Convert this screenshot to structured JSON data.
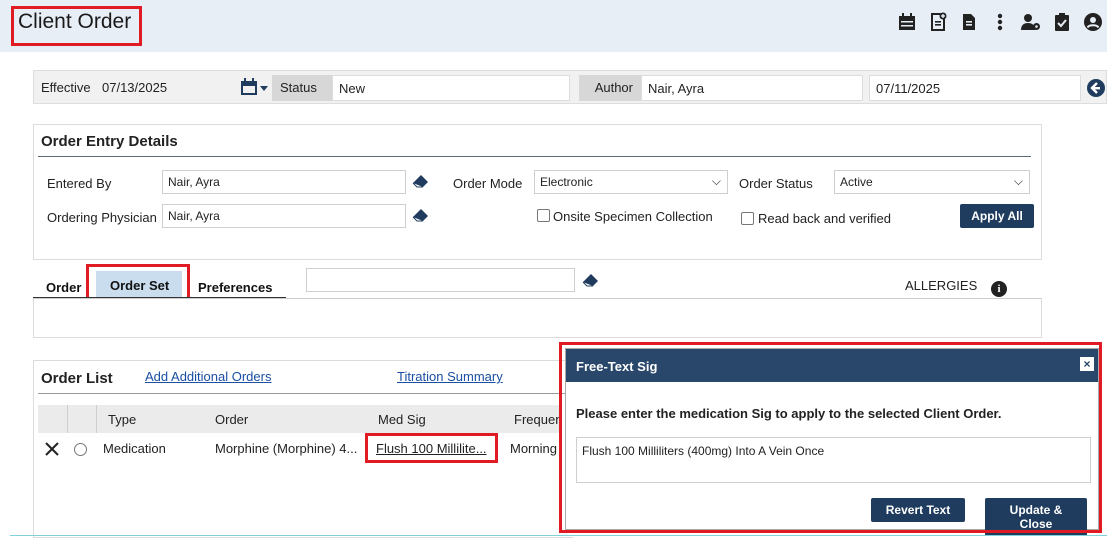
{
  "app": {
    "title": "Client Order"
  },
  "toolbar": {
    "icons": [
      "calendar-icon",
      "new-document-icon",
      "document-icon",
      "more-vert-icon",
      "user-settings-icon",
      "clipboard-check-icon",
      "user-circle-icon"
    ]
  },
  "header": {
    "effective_label": "Effective",
    "effective_value": "07/13/2025",
    "status_label": "Status",
    "status_value": "New",
    "author_label": "Author",
    "author_value": "Nair, Ayra",
    "date_value": "07/11/2025"
  },
  "order_entry": {
    "title": "Order Entry Details",
    "entered_by_label": "Entered By",
    "entered_by_value": "Nair, Ayra",
    "order_mode_label": "Order Mode",
    "order_mode_value": "Electronic",
    "order_status_label": "Order Status",
    "order_status_value": "Active",
    "ordering_physician_label": "Ordering Physician",
    "ordering_physician_value": "Nair, Ayra",
    "onsite_label": "Onsite Specimen Collection",
    "readback_label": "Read back and verified",
    "apply_all_label": "Apply All"
  },
  "tabs": {
    "items": [
      "Order",
      "Order Set",
      "Preferences"
    ],
    "allergies_label": "ALLERGIES",
    "info_glyph": "i"
  },
  "order_list": {
    "title": "Order List",
    "add_link": "Add Additional Orders",
    "titration_link": "Titration Summary",
    "columns": [
      "Type",
      "Order",
      "Med Sig",
      "Frequen"
    ],
    "rows": [
      {
        "type": "Medication",
        "order": "Morphine (Morphine) 4...",
        "med_sig": "Flush 100 Millilite...",
        "frequency": "Morning"
      }
    ]
  },
  "modal": {
    "title": "Free-Text Sig",
    "close_glyph": "×",
    "prompt": "Please enter the medication Sig to apply to the selected Client Order.",
    "text": "Flush 100 Milliliters (400mg) Into A Vein Once",
    "revert_label": "Revert Text",
    "update_label": "Update & Close"
  },
  "colors": {
    "accent_dark": "#1f3c5e",
    "modal_header": "#28476a",
    "highlight": "#e01b24",
    "tab_selected": "#c9ddef"
  }
}
